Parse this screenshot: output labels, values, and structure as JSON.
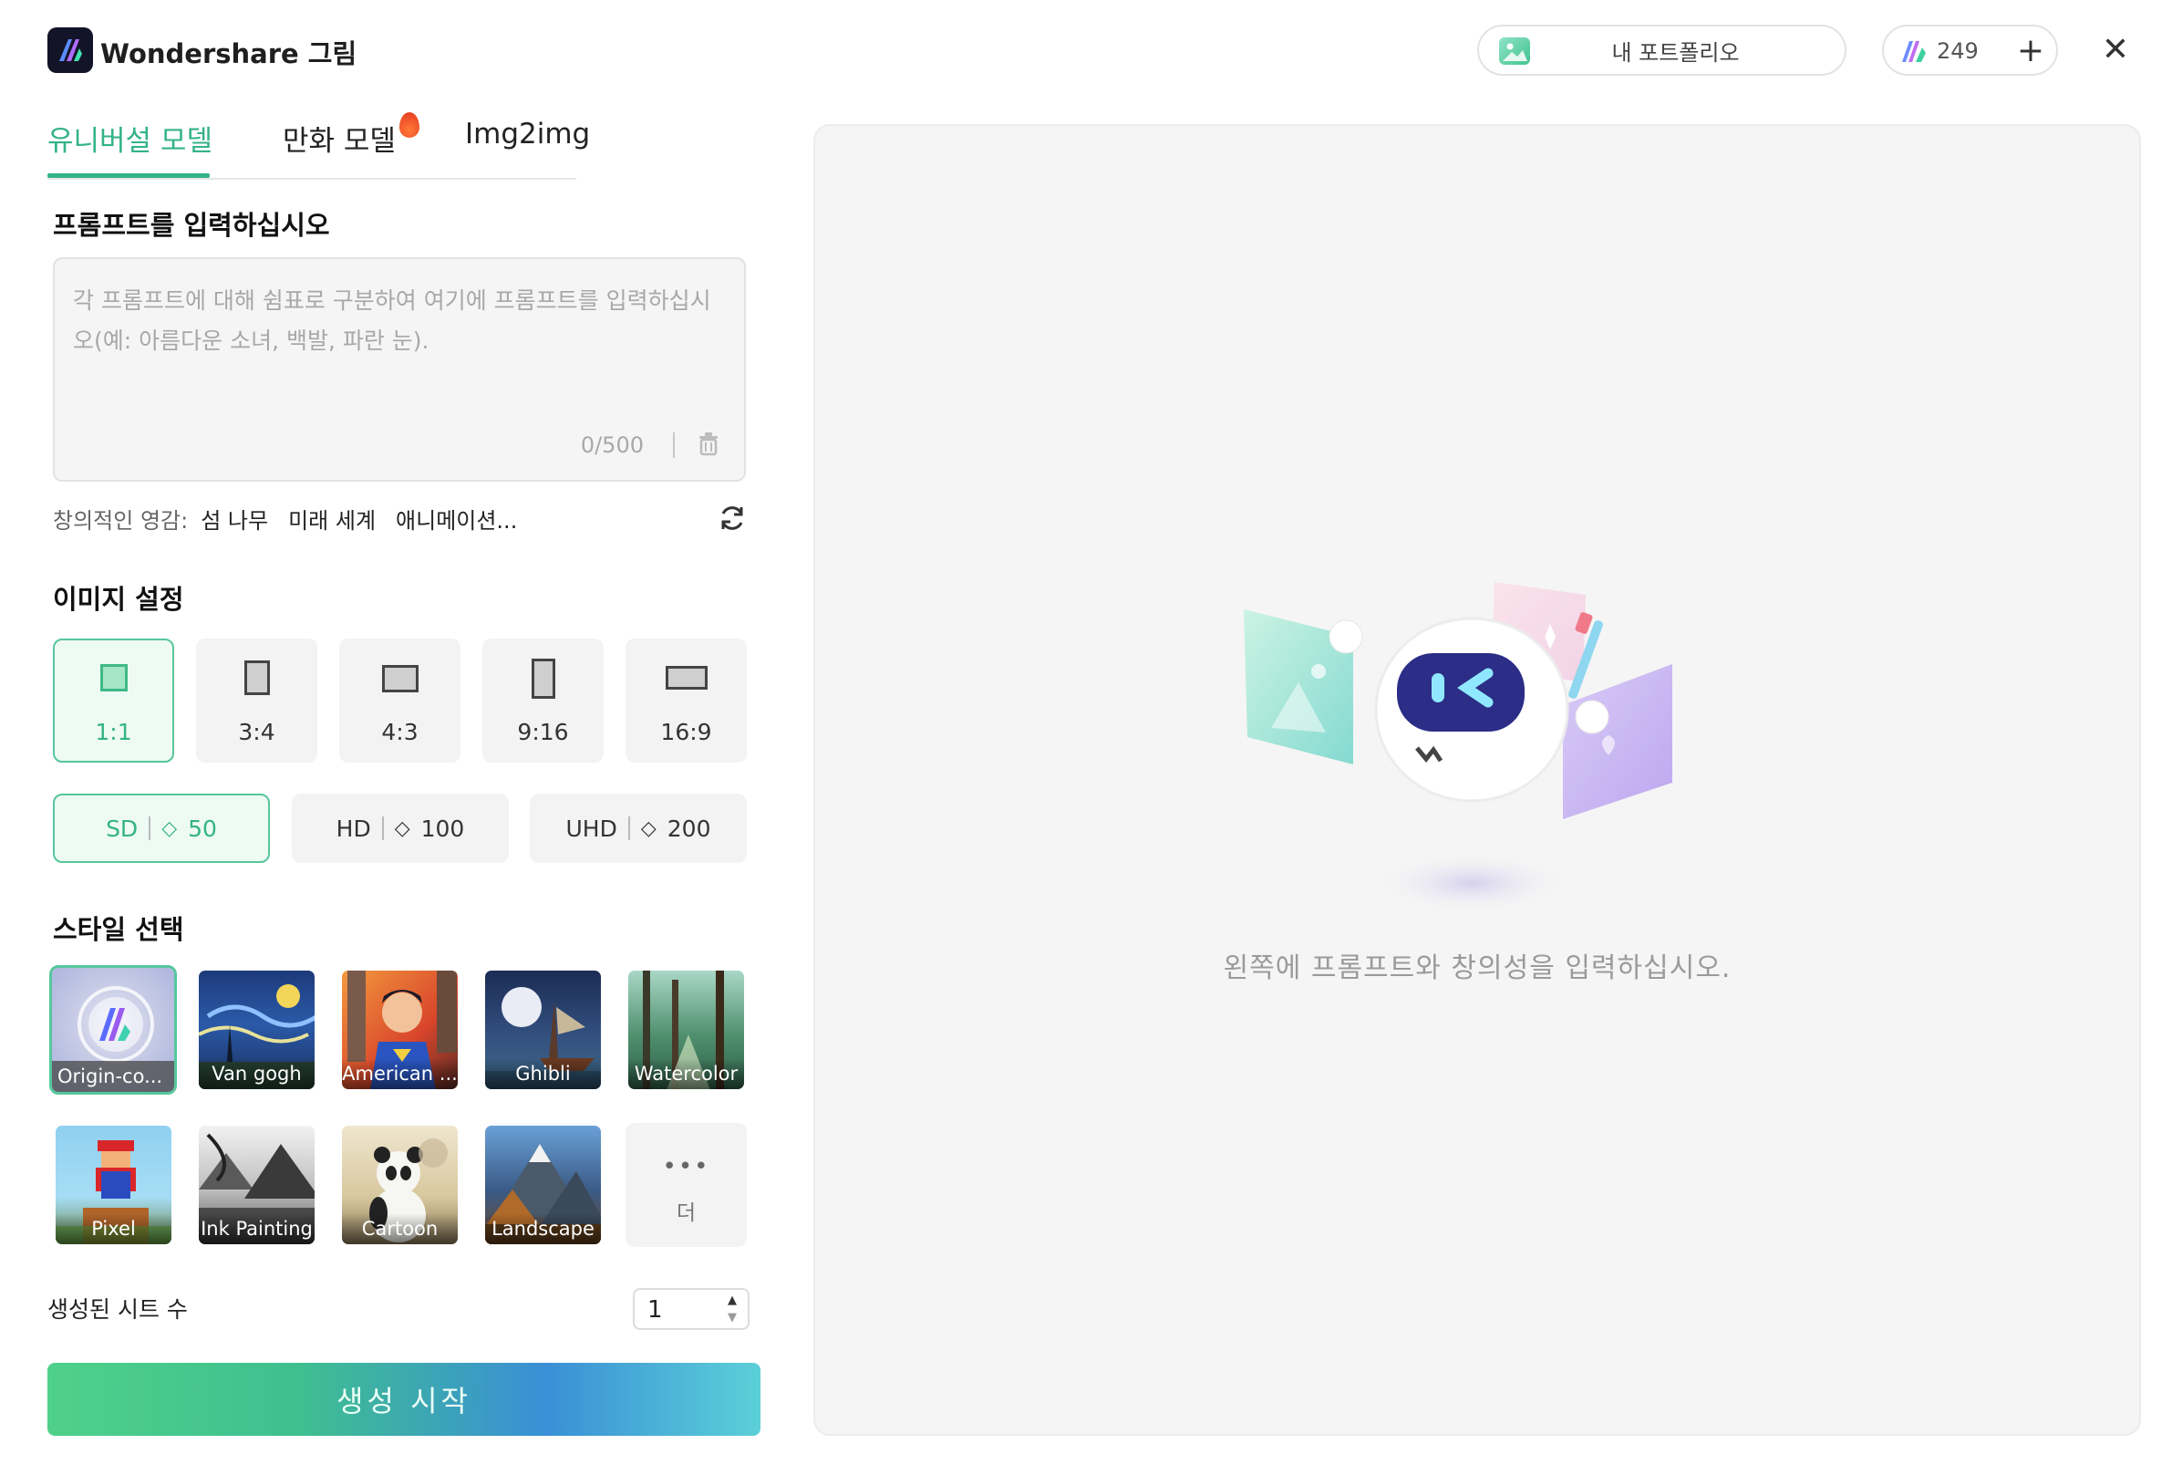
{
  "app": {
    "title": "Wondershare 그림",
    "portfolio_label": "내 포트폴리오",
    "credits": "249"
  },
  "tabs": [
    {
      "label": "유니버설 모델",
      "active": true
    },
    {
      "label": "만화 모델",
      "active": false,
      "badge": "fire-icon"
    },
    {
      "label": "Img2img",
      "active": false
    }
  ],
  "prompt": {
    "title": "프롬프트를 입력하십시오",
    "placeholder": "각 프롬프트에 대해 쉼표로 구분하여 여기에 프롬프트를 입력하십시오(예: 아름다운 소녀, 백발, 파란 눈).",
    "value": "",
    "counter": "0/500"
  },
  "inspiration": {
    "label": "창의적인 영감:",
    "chips": [
      "섬 나무",
      "미래 세계",
      "애니메이션..."
    ]
  },
  "image_settings": {
    "title": "이미지 설정",
    "ratios": [
      {
        "label": "1:1",
        "selected": true
      },
      {
        "label": "3:4",
        "selected": false
      },
      {
        "label": "4:3",
        "selected": false
      },
      {
        "label": "9:16",
        "selected": false
      },
      {
        "label": "16:9",
        "selected": false
      }
    ],
    "qualities": [
      {
        "label": "SD",
        "cost": "50",
        "selected": true
      },
      {
        "label": "HD",
        "cost": "100",
        "selected": false
      },
      {
        "label": "UHD",
        "cost": "200",
        "selected": false
      }
    ]
  },
  "styles": {
    "title": "스타일 선택",
    "items": [
      {
        "label": "Origin-co...",
        "selected": true
      },
      {
        "label": "Van gogh",
        "selected": false
      },
      {
        "label": "American ...",
        "selected": false
      },
      {
        "label": "Ghibli",
        "selected": false
      },
      {
        "label": "Watercolor",
        "selected": false
      },
      {
        "label": "Pixel",
        "selected": false
      },
      {
        "label": "Ink Painting",
        "selected": false
      },
      {
        "label": "Cartoon",
        "selected": false
      },
      {
        "label": "Landscape",
        "selected": false
      }
    ],
    "more_label": "더"
  },
  "sheets": {
    "label": "생성된 시트 수",
    "value": "1"
  },
  "generate_label": "생성 시작",
  "canvas": {
    "empty_hint": "왼쪽에 프롬프트와 창의성을 입력하십시오."
  },
  "colors": {
    "accent": "#34b387",
    "accent_border": "#56c79b",
    "panel_bg": "#f5f5f5"
  }
}
